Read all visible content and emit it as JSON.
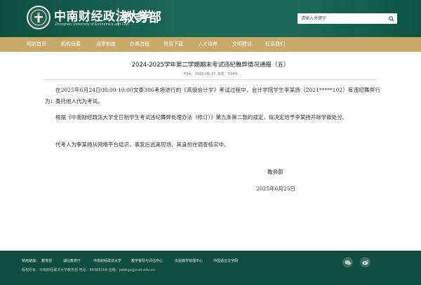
{
  "header": {
    "school_cn": "中南财经政法大学",
    "school_en": "Zhongnan University of Economics and Law",
    "dept": "教务部",
    "search_placeholder": "请输入关键字",
    "colors": {
      "primary": "#1a6a57",
      "nav": "#c8a96a",
      "footer": "#0e4e3e"
    }
  },
  "nav": {
    "items": [
      {
        "label": "网站首页"
      },
      {
        "label": "机构设置"
      },
      {
        "label": "规章制度"
      },
      {
        "label": "办事流程"
      },
      {
        "label": "常用下载"
      },
      {
        "label": "人才培养"
      },
      {
        "label": "文明建设"
      },
      {
        "label": "联系我们"
      }
    ]
  },
  "article": {
    "title": "2024-2025学年第二学期期末考试违纪舞弊情况通报（五）",
    "meta": "时间：2025-06-25    浏览：5049",
    "paragraphs": [
      "在2025年6月24日08:00-10:00文泰306考场进行的《高级会计学》考试过程中，会计学院学生李某扬（2021*****102）有违纪舞弊行为：委托他人代为考试。",
      "根据《中南财经政法大学全日制学生考试违纪舞弊处理办法（修订）》第九条第二款的规定，拟决定给予李某扬开除学籍处分。",
      "代考人为李某扬从网络平台结识，事发后逃离现场，其身份在调查核实中。"
    ],
    "signature": "教务部",
    "date": "2025年6月25日"
  },
  "footer": {
    "label": "常用链接：",
    "links": [
      {
        "label": "教育部"
      },
      {
        "label": "湖北教育厅"
      },
      {
        "label": "中南财经政法大学"
      },
      {
        "label": "教学督导与评估中心"
      },
      {
        "label": "实验教学管理中心"
      },
      {
        "label": "中国语言文字网"
      }
    ],
    "copyright": "版权所有：中南财经政法大学教务部  电话：88385008  信箱：jwbbgs@zuel.edu.cn",
    "social_icons": [
      "wechat-icon",
      "weibo-icon"
    ]
  }
}
